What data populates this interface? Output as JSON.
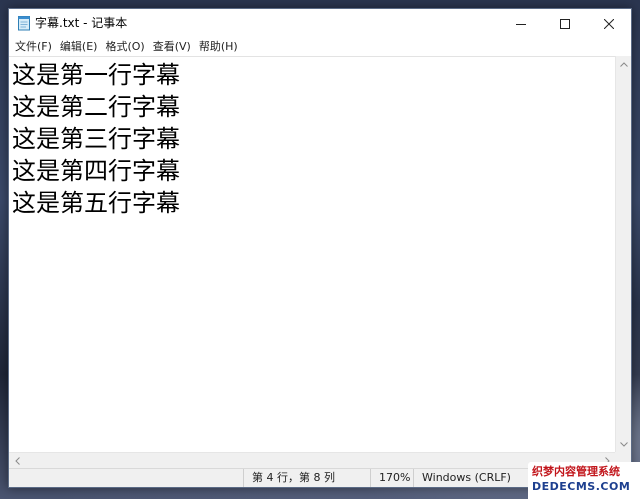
{
  "window": {
    "title": "字幕.txt - 记事本",
    "app_icon": "notepad-icon",
    "controls": {
      "minimize_icon": "minimize-icon",
      "maximize_icon": "maximize-icon",
      "close_icon": "close-icon"
    }
  },
  "menu": {
    "items": [
      {
        "label": "文件(F)"
      },
      {
        "label": "编辑(E)"
      },
      {
        "label": "格式(O)"
      },
      {
        "label": "查看(V)"
      },
      {
        "label": "帮助(H)"
      }
    ]
  },
  "editor": {
    "lines": [
      "这是第一行字幕",
      "这是第二行字幕",
      "这是第三行字幕",
      "这是第四行字幕",
      "这是第五行字幕"
    ]
  },
  "status": {
    "position": "第 4 行，第 8 列",
    "zoom": "170%",
    "line_ending": "Windows (CRLF)"
  },
  "watermark": {
    "top_text": "织梦内容管理系统",
    "bottom_text": "DEDECMS.COM"
  },
  "colors": {
    "desktop": "#2b3650",
    "window_bg": "#ffffff",
    "statusbar_bg": "#f0f0f0",
    "watermark_red": "#c2161c",
    "watermark_blue": "#1d3f8f"
  }
}
